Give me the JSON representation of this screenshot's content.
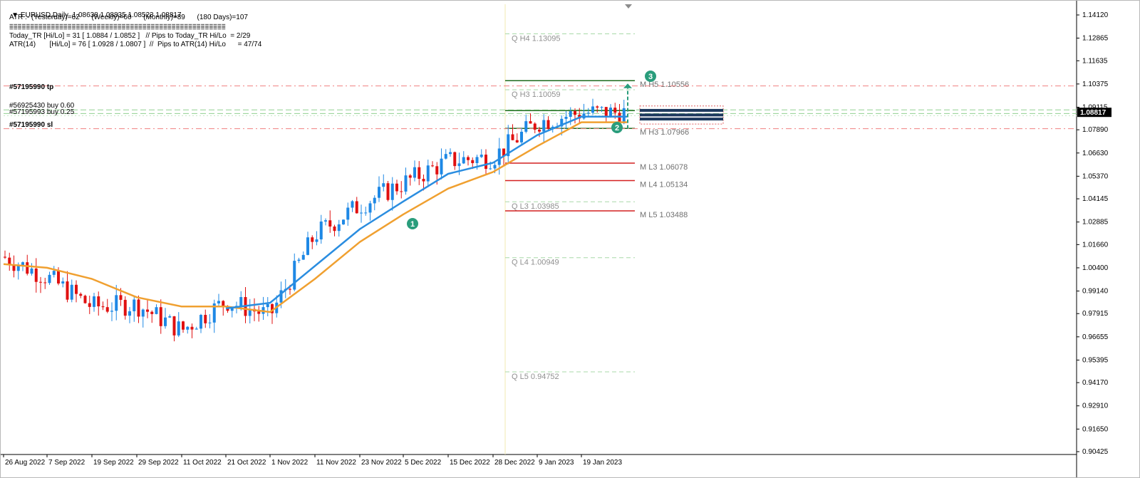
{
  "header": {
    "symbol_line": "EURUSD,Daily  1.08638 1.08835 1.08523 1.08817",
    "atr_line": "ATR :- (Yesterday)=62      (Weekly)=60      (Monthly)=89      (180 Days)=107",
    "separator1": "====================================================",
    "separator2": "====================================================",
    "today_tr_line": "Today_TR [Hi/Lo] = 31 [ 1.0884 / 1.0852 ]   // Pips to Today_TR Hi/Lo  = 2/29",
    "atr14_line": "ATR(14)       [Hi/Lo] = 76 [ 1.0928 / 1.0807 ]  //  Pips to ATR(14) Hi/Lo      = 47/74"
  },
  "order_labels": {
    "tp": "#57195990 tp",
    "buy1": "#56925430 buy 0.60",
    "buy2": "#57195993 buy 0.25",
    "sl": "#57195990 sl"
  },
  "price_axis": {
    "ticks": [
      "1.14120",
      "1.12865",
      "1.11635",
      "1.10375",
      "1.09115",
      "1.07890",
      "1.06630",
      "1.05370",
      "1.04145",
      "1.02885",
      "1.01660",
      "1.00400",
      "0.99140",
      "0.97915",
      "0.96655",
      "0.95395",
      "0.94170",
      "0.92910",
      "0.91650",
      "0.90425"
    ],
    "current_price": "1.08817"
  },
  "date_axis": {
    "labels": [
      "26 Aug 2022",
      "7 Sep 2022",
      "19 Sep 2022",
      "29 Sep 2022",
      "11 Oct 2022",
      "21 Oct 2022",
      "1 Nov 2022",
      "11 Nov 2022",
      "23 Nov 2022",
      "5 Dec 2022",
      "15 Dec 2022",
      "28 Dec 2022",
      "9 Jan 2023",
      "19 Jan 2023"
    ]
  },
  "pivots": {
    "quarterly": [
      {
        "label": "Q  H4 1.13095",
        "price": 1.13095
      },
      {
        "label": "Q  H3 1.10059",
        "price": 1.10059
      },
      {
        "label": "Q  L3 1.03985",
        "price": 1.03985
      },
      {
        "label": "Q  L4 1.00949",
        "price": 1.00949
      },
      {
        "label": "Q  L5 0.94752",
        "price": 0.94752
      }
    ],
    "monthly": [
      {
        "label": "M  H5 1.10556",
        "price": 1.10556
      },
      {
        "label": "M  H3 1.07966",
        "price": 1.07966
      },
      {
        "label": "M  L3 1.06078",
        "price": 1.06078
      },
      {
        "label": "M  L4 1.05134",
        "price": 1.05134
      },
      {
        "label": "M  L5 1.03488",
        "price": 1.03488
      }
    ]
  },
  "markers": [
    {
      "number": "1",
      "color": "#2a9d7c"
    },
    {
      "number": "2",
      "color": "#2a9d7c"
    },
    {
      "number": "3",
      "color": "#2a9d7c"
    }
  ],
  "colors": {
    "bull": "#1e88e5",
    "bear": "#e01010",
    "ema_fast": "#2a8de0",
    "ema_slow": "#f0a030",
    "tp_sl_line": "#f08080",
    "entry_line": "#90d090",
    "pivot_green": "#1d6b1d",
    "pivot_red": "#d42020",
    "quarterly_line": "#a8d8a8",
    "marker": "#2a9d7c"
  },
  "chart_data": {
    "type": "candlestick",
    "symbol": "EURUSD",
    "timeframe": "Daily",
    "ohlc_last": {
      "open": 1.08638,
      "high": 1.08835,
      "low": 1.08523,
      "close": 1.08817
    },
    "ylim": [
      0.903,
      1.145
    ],
    "x": [
      "26 Aug 2022",
      "7 Sep 2022",
      "19 Sep 2022",
      "29 Sep 2022",
      "11 Oct 2022",
      "21 Oct 2022",
      "1 Nov 2022",
      "11 Nov 2022",
      "23 Nov 2022",
      "5 Dec 2022",
      "15 Dec 2022",
      "28 Dec 2022",
      "9 Jan 2023",
      "19 Jan 2023"
    ],
    "close_approx": [
      1.01,
      0.999,
      0.983,
      0.984,
      0.97,
      0.986,
      0.978,
      1.022,
      1.038,
      1.05,
      1.062,
      1.064,
      1.083,
      1.0882
    ],
    "ema_fast_approx": [
      null,
      null,
      null,
      null,
      null,
      0.982,
      0.985,
      1.005,
      1.025,
      1.04,
      1.055,
      1.061,
      1.076,
      1.086
    ],
    "ema_slow_approx": [
      1.006,
      1.004,
      0.998,
      0.988,
      0.983,
      0.983,
      0.98,
      0.998,
      1.018,
      1.033,
      1.047,
      1.056,
      1.07,
      1.083
    ],
    "grid": false
  }
}
